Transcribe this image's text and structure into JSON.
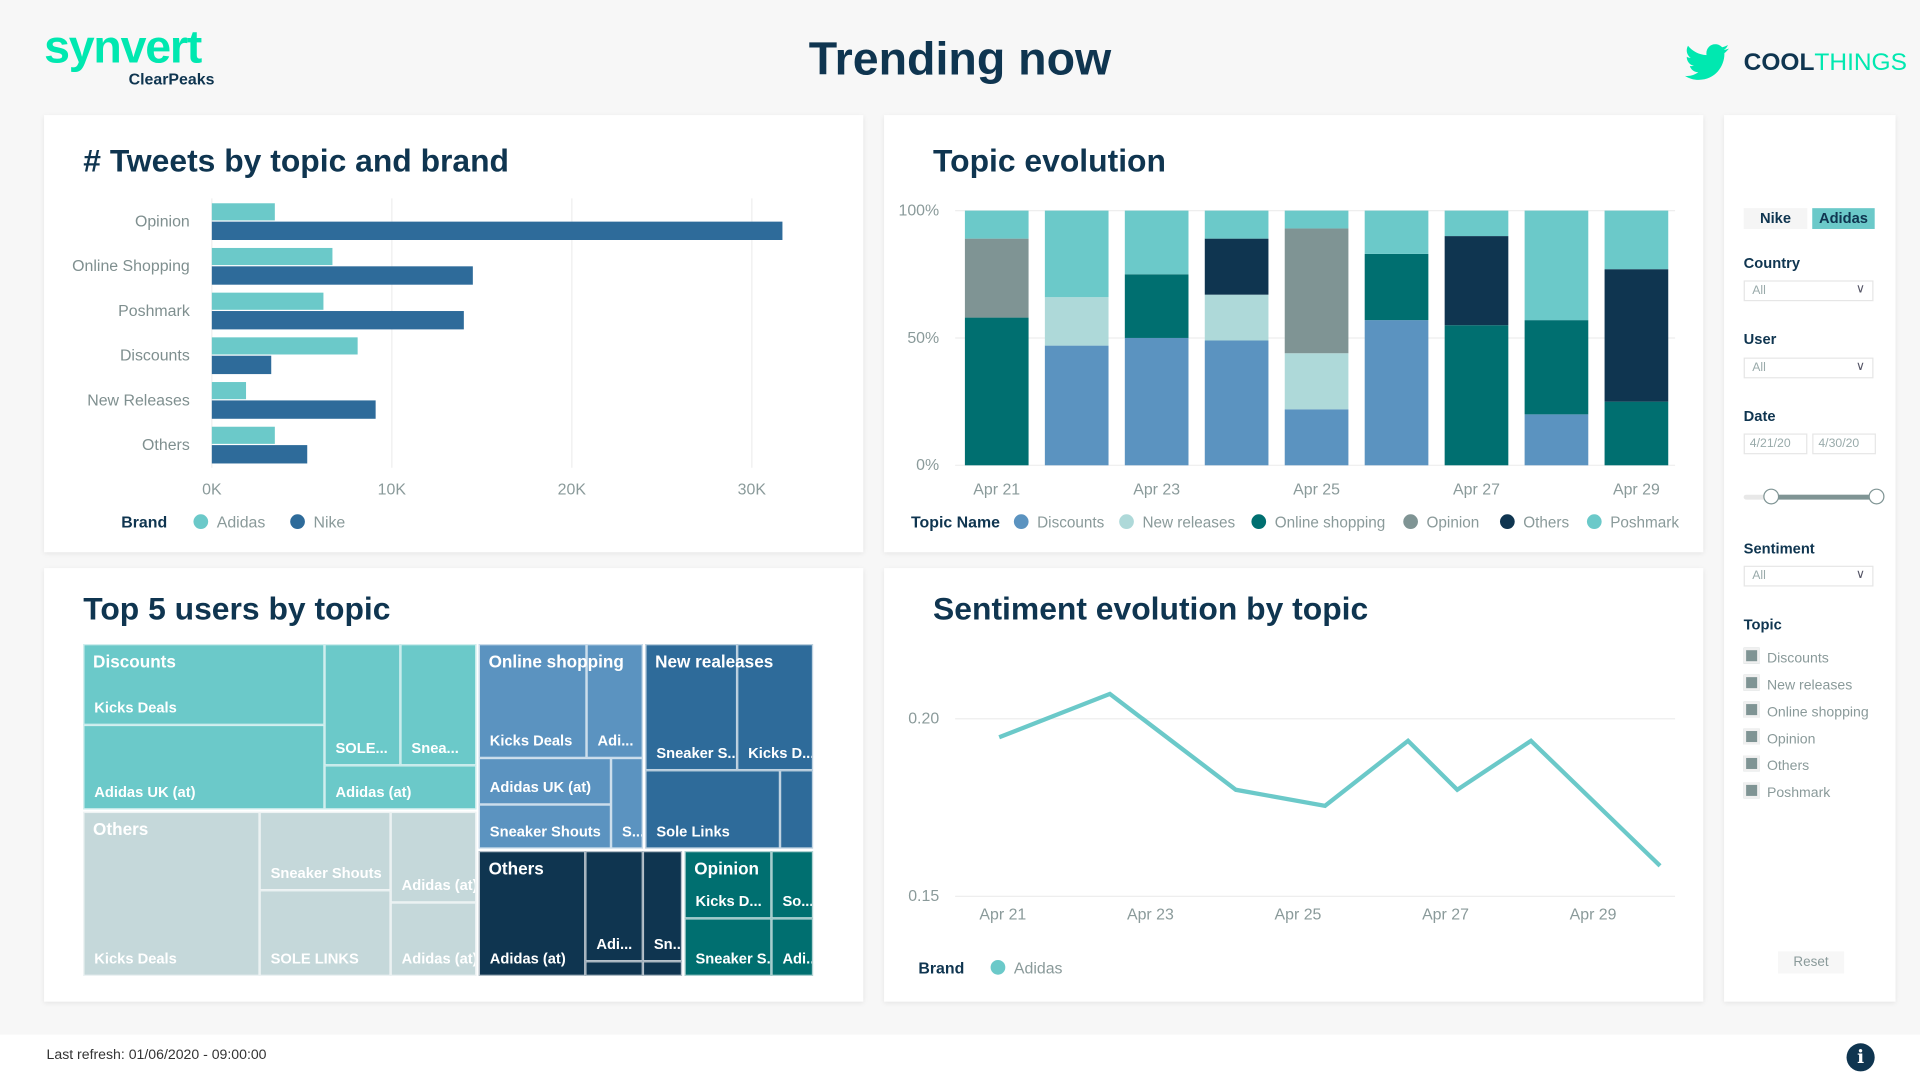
{
  "header": {
    "logo_main": "synvert",
    "logo_sub": "ClearPeaks",
    "title": "Trending now",
    "brand_logo_bold": "COOL",
    "brand_logo_light": "THINGS",
    "brand_icon": "twitter-bird-icon"
  },
  "colors": {
    "adidas": "#6bc9c9",
    "nike": "#2e6b9a",
    "Discounts": "#5b93c0",
    "New releases": "#aed9d9",
    "Online shopping": "#006f70",
    "Opinion": "#7f9494",
    "Others": "#0f3550",
    "Poshmark": "#6bc9c9",
    "accent": "#00e8b0"
  },
  "chart_data": [
    {
      "type": "bar",
      "orientation": "horizontal",
      "title": "# Tweets by topic and brand",
      "categories": [
        "Opinion",
        "Online Shopping",
        "Poshmark",
        "Discounts",
        "New Releases",
        "Others"
      ],
      "series": [
        {
          "name": "Adidas",
          "values": [
            3500,
            6700,
            6200,
            8100,
            1900,
            3500
          ]
        },
        {
          "name": "Nike",
          "values": [
            31700,
            14500,
            14000,
            3300,
            9100,
            5300
          ]
        }
      ],
      "xlim": [
        0,
        30000
      ],
      "xticks": [
        "0K",
        "10K",
        "20K",
        "30K"
      ],
      "grid": true,
      "legend_title": "Brand",
      "legend_placement": "bottom-left"
    },
    {
      "type": "bar",
      "stacked": "percent",
      "title": "Topic evolution",
      "categories": [
        "Apr 21",
        "Apr 22",
        "Apr 23",
        "Apr 24",
        "Apr 25",
        "Apr 26",
        "Apr 27",
        "Apr 28",
        "Apr 29"
      ],
      "xticks": [
        "Apr 21",
        "Apr 23",
        "Apr 25",
        "Apr 27",
        "Apr 29"
      ],
      "yticks": [
        "0%",
        "50%",
        "100%"
      ],
      "ylim": [
        0,
        100
      ],
      "series": [
        {
          "name": "Discounts",
          "values": [
            0,
            47,
            50,
            49,
            22,
            57,
            0,
            20,
            0
          ]
        },
        {
          "name": "New releases",
          "values": [
            0,
            19,
            0,
            18,
            22,
            0,
            0,
            0,
            0
          ]
        },
        {
          "name": "Online shopping",
          "values": [
            58,
            0,
            25,
            0,
            0,
            26,
            55,
            37,
            25
          ]
        },
        {
          "name": "Opinion",
          "values": [
            31,
            0,
            0,
            0,
            49,
            0,
            0,
            0,
            0
          ]
        },
        {
          "name": "Others",
          "values": [
            0,
            0,
            0,
            22,
            0,
            0,
            35,
            0,
            52
          ]
        },
        {
          "name": "Poshmark",
          "values": [
            11,
            34,
            25,
            11,
            7,
            17,
            10,
            43,
            23
          ]
        }
      ],
      "legend_title": "Topic Name",
      "legend_placement": "bottom"
    },
    {
      "type": "treemap",
      "title": "Top 5 users by topic",
      "groups": [
        {
          "name": "Discounts",
          "items": [
            "Kicks Deals",
            "Adidas UK (at)",
            "SOLE...",
            "Snea...",
            "Adidas (at)"
          ]
        },
        {
          "name": "Others",
          "items": [
            "Kicks Deals",
            "Sneaker Shouts",
            "SOLE LINKS",
            "Adidas (at)",
            "Adidas (at)"
          ]
        },
        {
          "name": "Online shopping",
          "items": [
            "Kicks Deals",
            "Adi...",
            "Adidas UK (at)",
            "Sneaker Shouts",
            "S..."
          ]
        },
        {
          "name": "New realeases",
          "items": [
            "Sneaker S...",
            "Kicks D...",
            "Sole Links",
            ""
          ]
        },
        {
          "name": "Others",
          "items": [
            "Adidas (at)",
            "Adi...",
            "Sn...",
            "",
            ""
          ]
        },
        {
          "name": "Opinion",
          "items": [
            "Kicks D...",
            "So...",
            "Sneaker S...",
            "Adi..."
          ]
        }
      ]
    },
    {
      "type": "line",
      "title": "Sentiment evolution by topic",
      "x": [
        "2020-04-21T00:00",
        "2020-04-22T12:00",
        "2020-04-24T05:00",
        "2020-04-25T10:00",
        "2020-04-26T13:00",
        "2020-04-27T05:00",
        "2020-04-28T05:00",
        "2020-04-29T23:00"
      ],
      "series": [
        {
          "name": "Adidas",
          "values": [
            0.1948,
            0.207,
            0.18,
            0.1755,
            0.1938,
            0.18,
            0.1938,
            0.1586
          ]
        }
      ],
      "xticks": [
        "Apr 21",
        "Apr 23",
        "Apr 25",
        "Apr 27",
        "Apr 29"
      ],
      "yticks": [
        "0.15",
        "0.20"
      ],
      "ylim": [
        0.15,
        0.2
      ],
      "grid": true,
      "legend_title": "Brand",
      "legend_placement": "bottom-left"
    }
  ],
  "sidebar": {
    "brand_toggle": [
      {
        "label": "Nike",
        "selected": false
      },
      {
        "label": "Adidas",
        "selected": true
      }
    ],
    "country": {
      "label": "Country",
      "value": "All"
    },
    "user": {
      "label": "User",
      "value": "All"
    },
    "date": {
      "label": "Date",
      "start": "4/21/20",
      "end": "4/30/20",
      "slider_range": [
        0.2,
        1.0
      ]
    },
    "sentiment": {
      "label": "Sentiment",
      "value": "All"
    },
    "topic": {
      "label": "Topic",
      "items": [
        "Discounts",
        "New releases",
        "Online shopping",
        "Opinion",
        "Others",
        "Poshmark"
      ]
    },
    "reset_label": "Reset"
  },
  "footer": {
    "last_refresh": "Last refresh: 01/06/2020 - 09:00:00",
    "info_icon": "info-icon"
  }
}
